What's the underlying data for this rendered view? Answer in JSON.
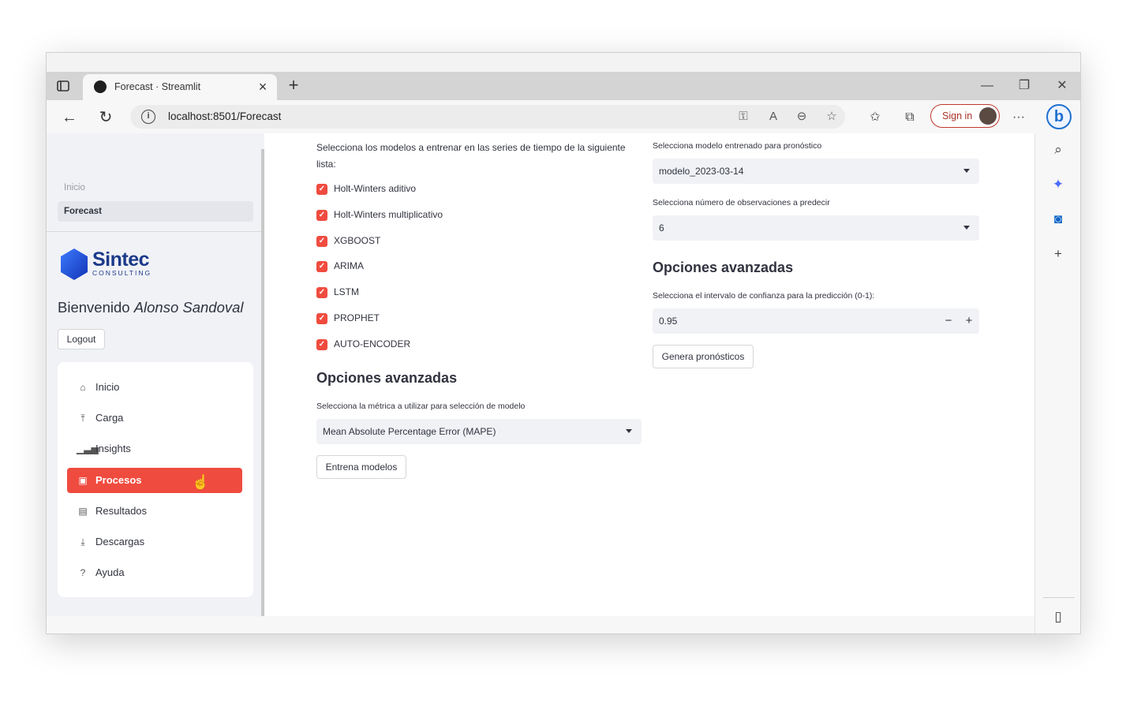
{
  "browser": {
    "tab_title": "Forecast · Streamlit",
    "url": "localhost:8501/Forecast",
    "sign_in": "Sign in"
  },
  "sidebar": {
    "pages": [
      "Inicio",
      "Forecast"
    ],
    "active_page": "Forecast",
    "logo_name": "Sintec",
    "logo_sub": "CONSULTING",
    "welcome_prefix": "Bienvenido ",
    "user_name": "Alonso Sandoval",
    "logout_label": "Logout",
    "menu": [
      {
        "label": "Inicio",
        "icon": "house-icon"
      },
      {
        "label": "Carga",
        "icon": "upload-icon"
      },
      {
        "label": "Insights",
        "icon": "bar-chart-icon"
      },
      {
        "label": "Procesos",
        "icon": "play-icon"
      },
      {
        "label": "Resultados",
        "icon": "document-icon"
      },
      {
        "label": "Descargas",
        "icon": "download-icon"
      },
      {
        "label": "Ayuda",
        "icon": "help-icon"
      }
    ],
    "active_menu": "Procesos"
  },
  "left_column": {
    "instructions": "Selecciona los modelos a entrenar en las series de tiempo de la siguiente lista:",
    "models": [
      {
        "label": "Holt-Winters aditivo",
        "checked": true
      },
      {
        "label": "Holt-Winters multiplicativo",
        "checked": true
      },
      {
        "label": "XGBOOST",
        "checked": true
      },
      {
        "label": "ARIMA",
        "checked": true
      },
      {
        "label": "LSTM",
        "checked": true
      },
      {
        "label": "PROPHET",
        "checked": true
      },
      {
        "label": "AUTO-ENCODER",
        "checked": true
      }
    ],
    "advanced_title": "Opciones avanzadas",
    "metric_label": "Selecciona la métrica a utilizar para selección de modelo",
    "metric_value": "Mean Absolute Percentage Error (MAPE)",
    "train_button": "Entrena modelos"
  },
  "right_column": {
    "model_label": "Selecciona modelo entrenado para pronóstico",
    "model_value": "modelo_2023-03-14",
    "obs_label": "Selecciona número de observaciones a predecir",
    "obs_value": "6",
    "advanced_title": "Opciones avanzadas",
    "confidence_label": "Selecciona el intervalo de confianza para la predicción (0-1):",
    "confidence_value": "0.95",
    "minus": "−",
    "plus": "+",
    "forecast_button": "Genera pronósticos"
  },
  "colors": {
    "accent": "#f04b3f",
    "sidebar_bg": "#f0f2f6",
    "brand": "#1c3a8a"
  }
}
